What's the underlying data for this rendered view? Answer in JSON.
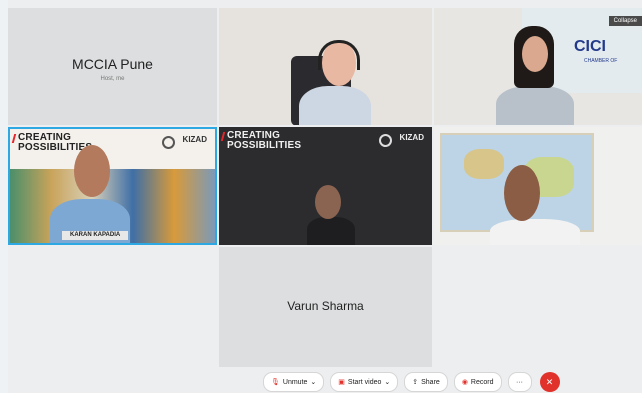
{
  "participants": {
    "tile1": {
      "name": "MCCIA Pune",
      "sub": "Host, me"
    },
    "tile3": {
      "logo_text": "CICI",
      "logo_sub": "CHAMBER OF",
      "collapse_label": "Collapse"
    },
    "tile4": {
      "banner_title_1": "CREATING",
      "banner_title_2": "POSSIBILITIES",
      "brand": "KIZAD",
      "name_tag": "KARAN KAPADIA"
    },
    "tile5": {
      "banner_title_1": "CREATING",
      "banner_title_2": "POSSIBILITIES",
      "brand": "KIZAD"
    },
    "tile7": {
      "name": "Varun Sharma"
    }
  },
  "toolbar": {
    "unmute": "Unmute",
    "start_video": "Start video",
    "share": "Share",
    "record": "Record",
    "more": "···"
  },
  "colors": {
    "accent": "#2ea8e2",
    "end_call": "#e0312a"
  }
}
